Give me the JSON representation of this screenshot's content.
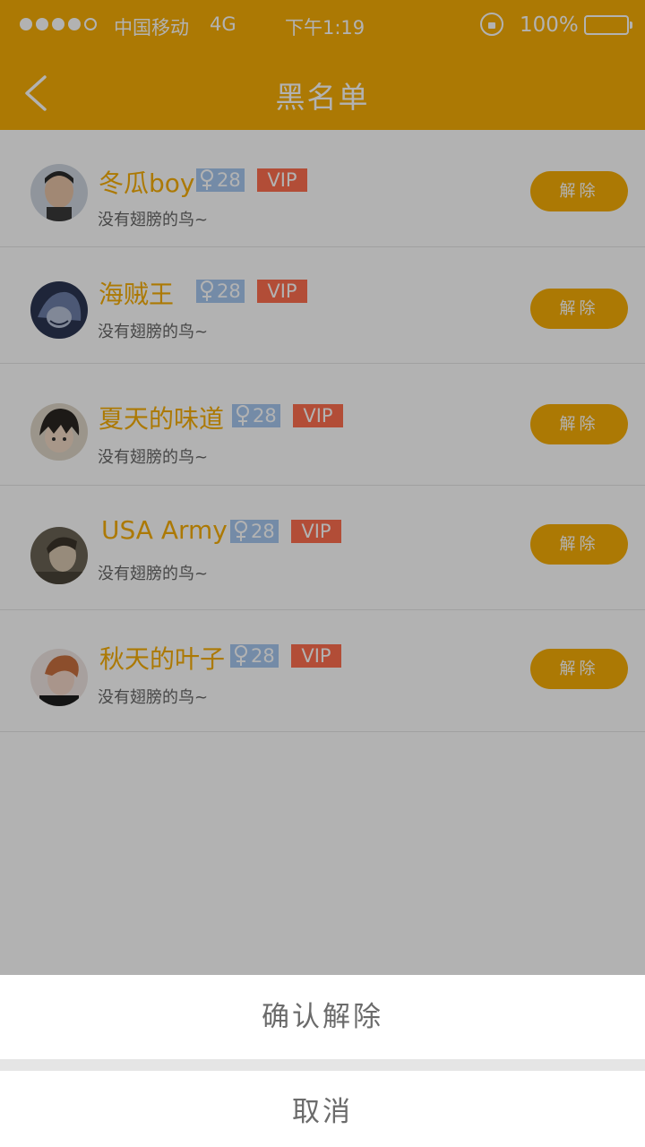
{
  "status_bar": {
    "carrier": "中国移动",
    "network": "4G",
    "time": "下午1:19",
    "battery": "100%",
    "signal_icon": "signal-dots-icon",
    "rotation_lock_icon": "rotation-lock-icon",
    "battery_icon": "battery-icon"
  },
  "nav": {
    "title": "黑名单",
    "back_icon": "chevron-left-icon"
  },
  "colors": {
    "accent": "#F6AE06",
    "gender_badge": "#a7c8f0",
    "vip_badge": "#ff6f4f"
  },
  "list": {
    "items": [
      {
        "name": "冬瓜boy",
        "age": "28",
        "vip": "VIP",
        "bio": "没有翅膀的鸟~",
        "action": "解除"
      },
      {
        "name": "海贼王",
        "age": "28",
        "vip": "VIP",
        "bio": "没有翅膀的鸟~",
        "action": "解除"
      },
      {
        "name": "夏天的味道",
        "age": "28",
        "vip": "VIP",
        "bio": "没有翅膀的鸟~",
        "action": "解除"
      },
      {
        "name": "USA Army",
        "age": "28",
        "vip": "VIP",
        "bio": "没有翅膀的鸟~",
        "action": "解除"
      },
      {
        "name": "秋天的叶子",
        "age": "28",
        "vip": "VIP",
        "bio": "没有翅膀的鸟~",
        "action": "解除"
      }
    ]
  },
  "action_sheet": {
    "confirm": "确认解除",
    "cancel": "取消"
  }
}
